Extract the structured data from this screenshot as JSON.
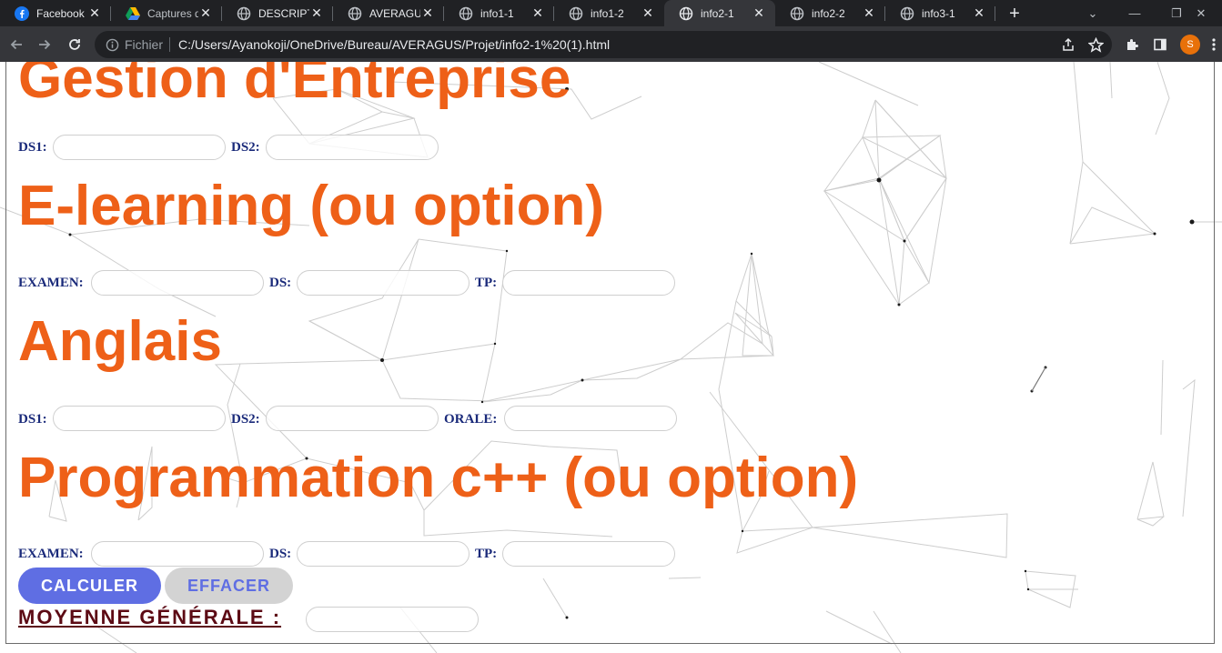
{
  "browser": {
    "tabs": [
      {
        "title": "Facebook",
        "icon": "facebook-icon",
        "active": false
      },
      {
        "title": "Captures d",
        "icon": "google-drive-icon",
        "active": false
      },
      {
        "title": "DESCRIPTI",
        "icon": "globe-icon",
        "active": false
      },
      {
        "title": "AVERAGUS",
        "icon": "globe-icon",
        "active": false
      },
      {
        "title": "info1-1",
        "icon": "globe-icon",
        "active": false
      },
      {
        "title": "info1-2",
        "icon": "globe-icon",
        "active": false
      },
      {
        "title": "info2-1",
        "icon": "globe-icon",
        "active": true
      },
      {
        "title": "info2-2",
        "icon": "globe-icon",
        "active": false
      },
      {
        "title": "info3-1",
        "icon": "globe-icon",
        "active": false
      }
    ],
    "security_label": "Fichier",
    "url": "C:/Users/Ayanokoji/OneDrive/Bureau/AVERAGUS/Projet/info2-1%20(1).html",
    "profile_initial": "S"
  },
  "page": {
    "subjects": [
      {
        "title": "Gestion d'Entreprise",
        "fields": [
          {
            "label": "DS1:",
            "value": ""
          },
          {
            "label": "DS2:",
            "value": ""
          }
        ]
      },
      {
        "title": "E-learning (ou option)",
        "fields": [
          {
            "label": "EXAMEN:",
            "value": ""
          },
          {
            "label": "DS:",
            "value": ""
          },
          {
            "label": "TP:",
            "value": ""
          }
        ]
      },
      {
        "title": "Anglais",
        "fields": [
          {
            "label": "DS1:",
            "value": ""
          },
          {
            "label": "DS2:",
            "value": ""
          },
          {
            "label": "ORALE:",
            "value": ""
          }
        ]
      },
      {
        "title": "Programmation c++ (ou option)",
        "fields": [
          {
            "label": "EXAMEN:",
            "value": ""
          },
          {
            "label": "DS:",
            "value": ""
          },
          {
            "label": "TP:",
            "value": ""
          }
        ]
      }
    ],
    "calculate_button": "CALCULER",
    "clear_button": "EFFACER",
    "result_label": "MOYENNE GÉNÉRALE :",
    "result_value": ""
  },
  "colors": {
    "heading": "#ee6018",
    "field_label": "#1a2a7a",
    "calculate_bg": "#5f6ee3",
    "clear_bg": "#d3d3d3",
    "result_label": "#5c0a14"
  }
}
